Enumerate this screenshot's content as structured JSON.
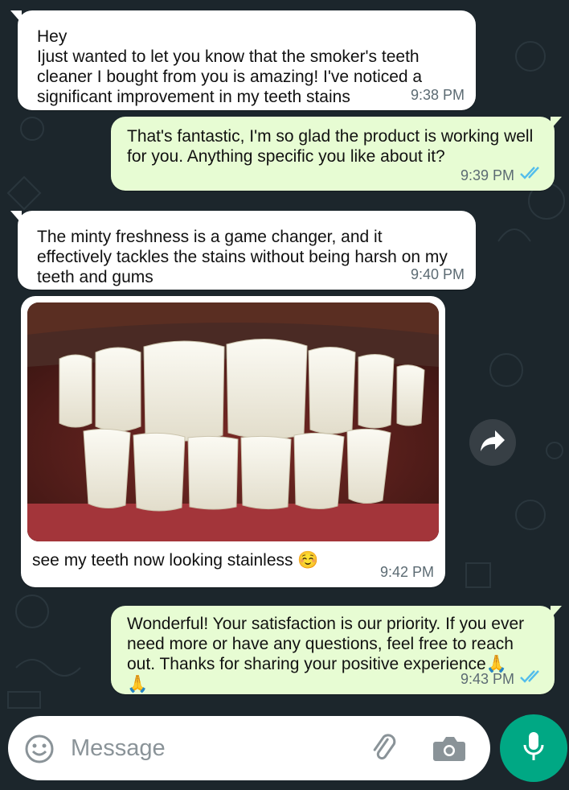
{
  "messages": [
    {
      "direction": "incoming",
      "text": "Hey\nIjust wanted to let you know that the smoker's teeth cleaner I bought from you is amazing! I've noticed a significant improvement in my teeth stains",
      "time": "9:38 PM"
    },
    {
      "direction": "outgoing",
      "text": "That's fantastic, I'm so glad the product is working well for you. Anything specific you like about it?",
      "time": "9:39 PM",
      "status": "read"
    },
    {
      "direction": "incoming",
      "text": "The minty freshness is a game changer, and it effectively tackles the stains without being harsh on my teeth and gums",
      "time": "9:40 PM"
    },
    {
      "direction": "incoming",
      "type": "image",
      "caption": "see my teeth now looking stainless ☺️",
      "time": "9:42 PM"
    },
    {
      "direction": "outgoing",
      "text": "Wonderful! Your satisfaction is our priority. If you ever need more or have any questions, feel free to reach out. Thanks for sharing your positive experience🙏\n🙏",
      "time": "9:43 PM",
      "status": "read"
    }
  ],
  "composer": {
    "placeholder": "Message"
  },
  "icons": {
    "emoji": "emoji-icon",
    "attach": "paperclip-icon",
    "camera": "camera-icon",
    "mic": "microphone-icon",
    "forward": "forward-arrow-icon",
    "read_ticks": "double-check-icon"
  },
  "colors": {
    "incoming_bubble": "#ffffff",
    "outgoing_bubble": "#e7fcd3",
    "accent": "#00a884",
    "read_ticks": "#53bdeb"
  }
}
